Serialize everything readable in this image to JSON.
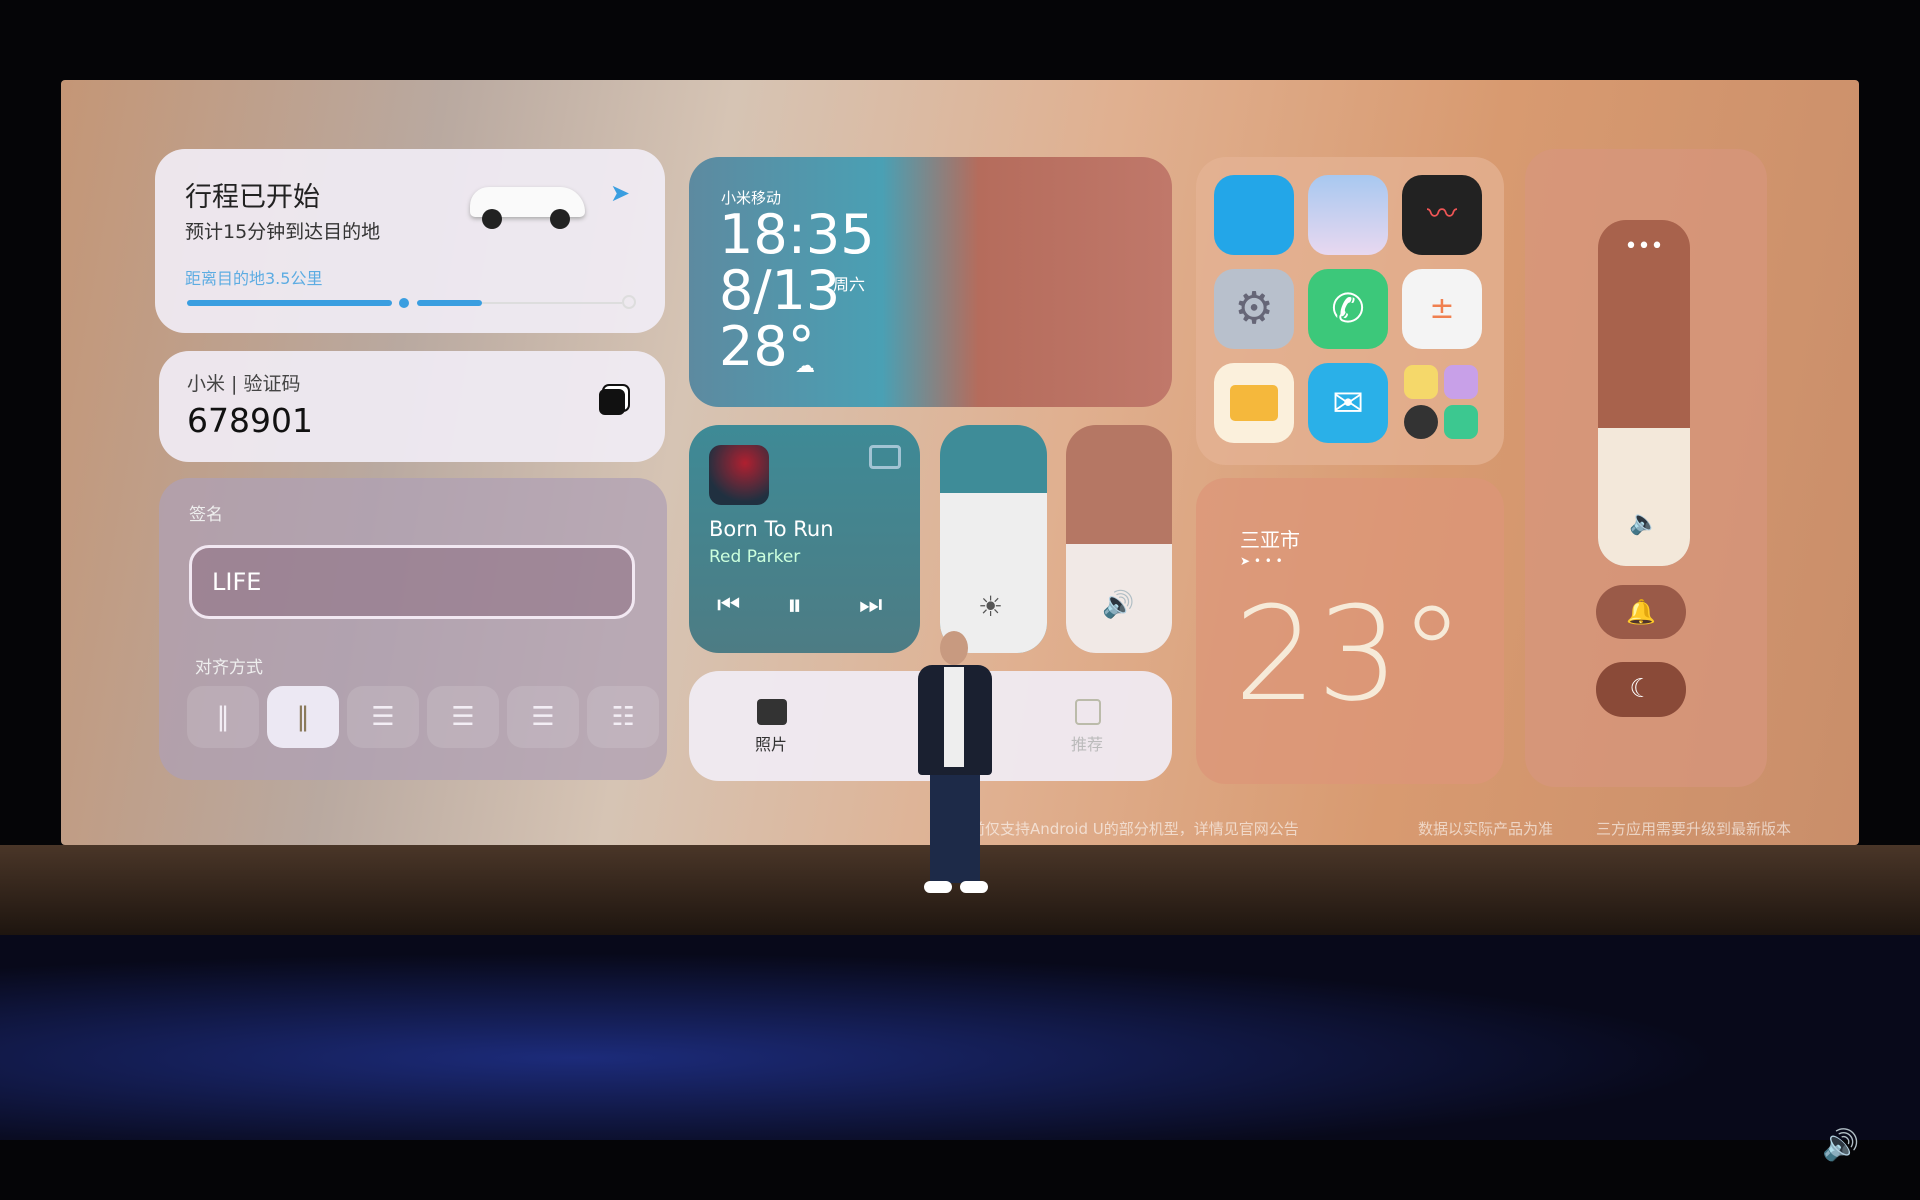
{
  "trip": {
    "title": "行程已开始",
    "subtitle": "预计15分钟到达目的地",
    "distance": "距离目的地3.5公里",
    "progress": 0.66,
    "accent": "#3a9ee0"
  },
  "code": {
    "source": "小米 | 验证码",
    "value": "678901"
  },
  "signature": {
    "label": "签名",
    "value": "LIFE",
    "align_label": "对齐方式",
    "align_options": [
      "vertical-left",
      "vertical-right",
      "left",
      "center",
      "right",
      "justify"
    ],
    "selected_align": 1
  },
  "clock": {
    "carrier": "小米移动",
    "time": "18:35",
    "date": "8/13",
    "weekday": "周六",
    "temp": "28°",
    "weather_icon": "cloud-icon"
  },
  "music": {
    "title": "Born To Run",
    "artist": "Red Parker"
  },
  "brightness": {
    "level": 0.7
  },
  "volume": {
    "level": 0.48
  },
  "shortcuts": {
    "items": [
      {
        "label": "照片"
      },
      {
        "label": "推荐"
      }
    ]
  },
  "apps": [
    "browser",
    "gallery",
    "recorder",
    "settings",
    "phone",
    "calculator",
    "files",
    "mail",
    "notes-clock-security"
  ],
  "weather": {
    "city": "三亚市",
    "temp": "23°"
  },
  "ringer": {
    "level": 0.4
  },
  "footer": {
    "note1": "前仅支持Android U的部分机型，详情见官网公告",
    "note2": "数据以实际产品为准",
    "note3": "三方应用需要升级到最新版本"
  }
}
